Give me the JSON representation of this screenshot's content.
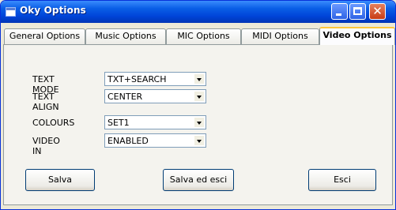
{
  "window": {
    "title": "Oky Options"
  },
  "tabs": [
    {
      "label": "General Options"
    },
    {
      "label": "Music Options"
    },
    {
      "label": "MIC Options"
    },
    {
      "label": "MIDI Options"
    },
    {
      "label": "Video Options",
      "active": true
    }
  ],
  "settings": [
    {
      "label": "TEXT MODE",
      "value": "TXT+SEARCH"
    },
    {
      "label": "TEXT ALIGN",
      "value": "CENTER"
    },
    {
      "label": "COLOURS",
      "value": "SET1"
    },
    {
      "label": "VIDEO IN",
      "value": "ENABLED"
    }
  ],
  "buttons": {
    "save": "Salva",
    "save_exit": "Salva ed esci",
    "exit": "Esci"
  }
}
